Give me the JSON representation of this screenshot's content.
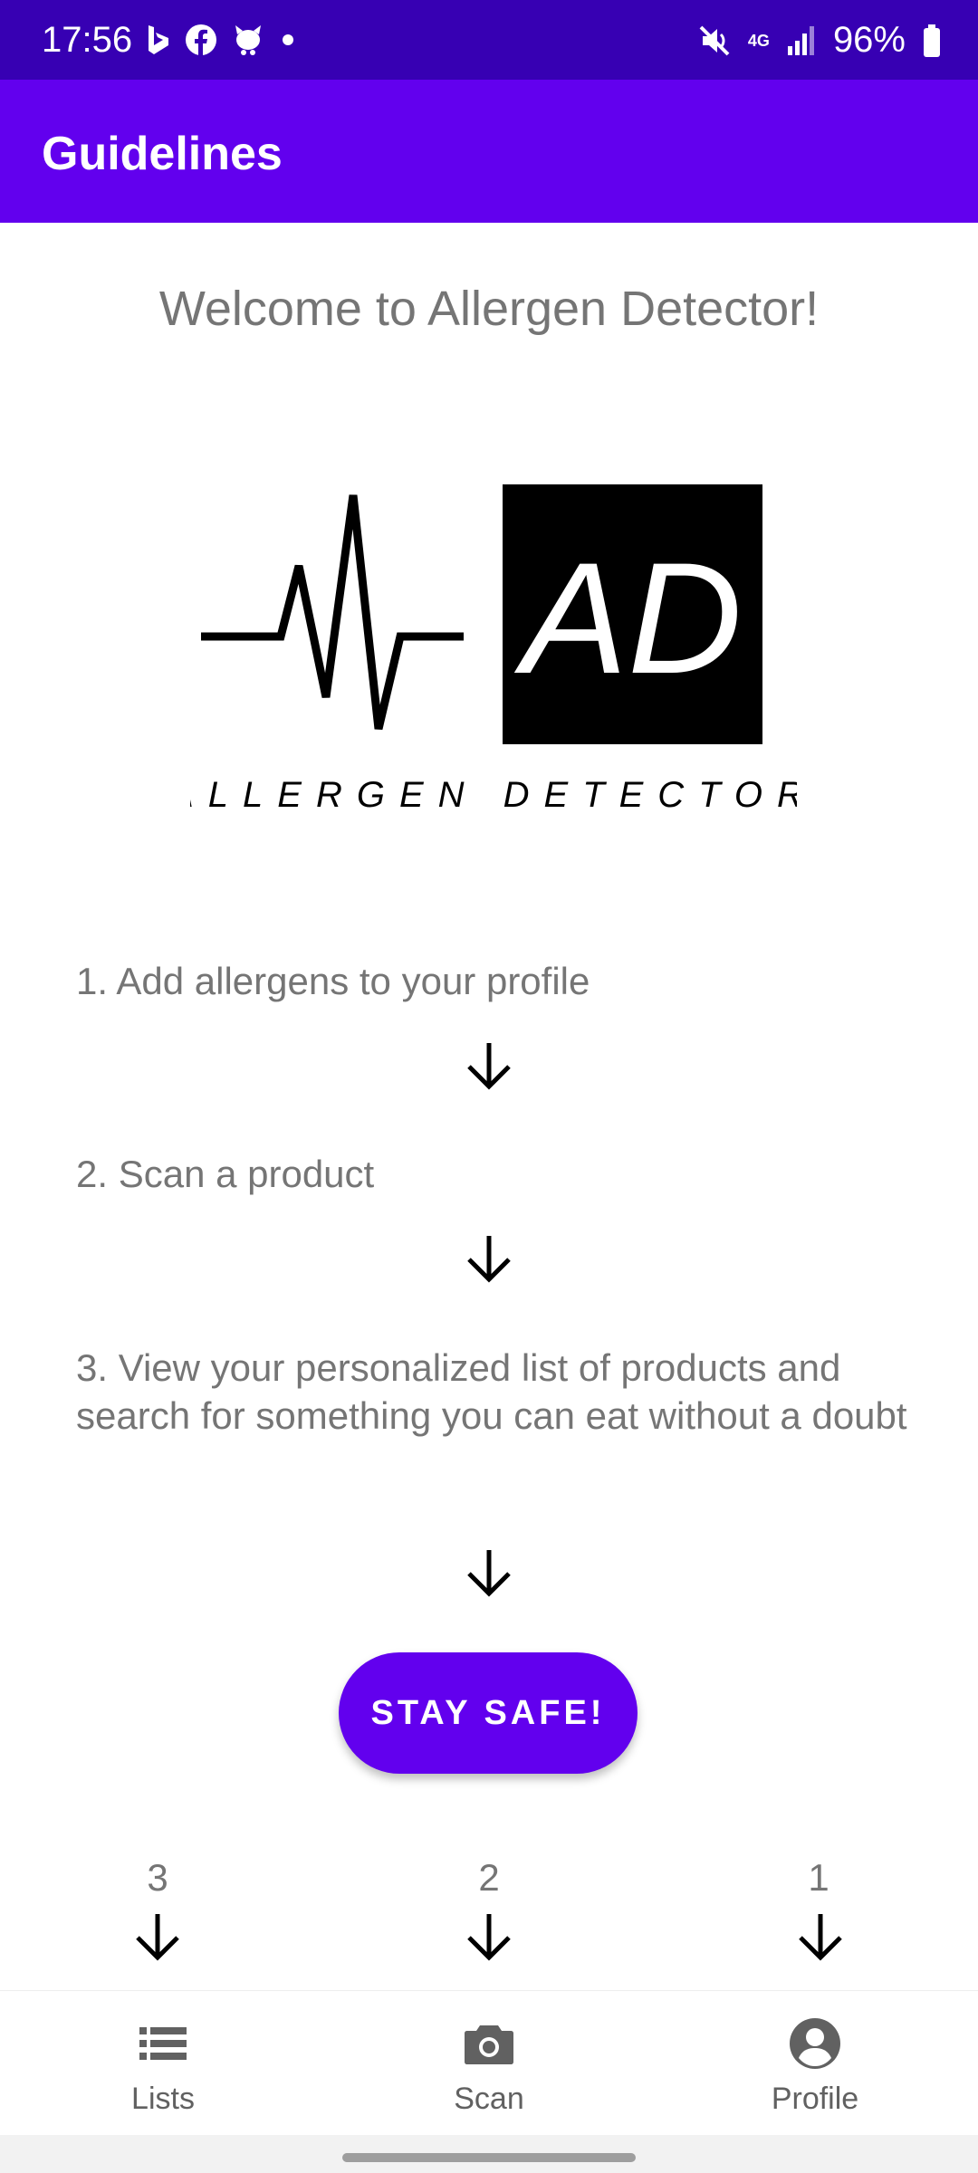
{
  "status_bar": {
    "time": "17:56",
    "network": "4G",
    "battery": "96%",
    "left_icons": [
      "bing-icon",
      "facebook-icon",
      "notification-cat-icon",
      "dot-icon"
    ],
    "right_icons": [
      "mute-icon",
      "network-4g-icon",
      "signal-icon",
      "battery-icon"
    ]
  },
  "app_bar": {
    "title": "Guidelines",
    "color": "#6200ee"
  },
  "main": {
    "welcome": "Welcome to Allergen Detector!",
    "logo": {
      "monogram": "AD",
      "wordmark": "ALLERGEN DETECTOR"
    },
    "steps": [
      {
        "text": "1. Add allergens to your profile"
      },
      {
        "text": "2. Scan a product"
      },
      {
        "text": "3. View your personalized list of products and search for something you can eat without a doubt"
      }
    ],
    "cta_label": "STAY SAFE!",
    "nav_pointers": [
      {
        "label": "3"
      },
      {
        "label": "2"
      },
      {
        "label": "1"
      }
    ]
  },
  "bottom_nav": {
    "items": [
      {
        "label": "Lists",
        "icon": "list-icon"
      },
      {
        "label": "Scan",
        "icon": "camera-icon"
      },
      {
        "label": "Profile",
        "icon": "account-icon"
      }
    ]
  },
  "colors": {
    "primary": "#6200ee",
    "primary_dark": "#3700b3",
    "text_secondary": "#757575"
  }
}
